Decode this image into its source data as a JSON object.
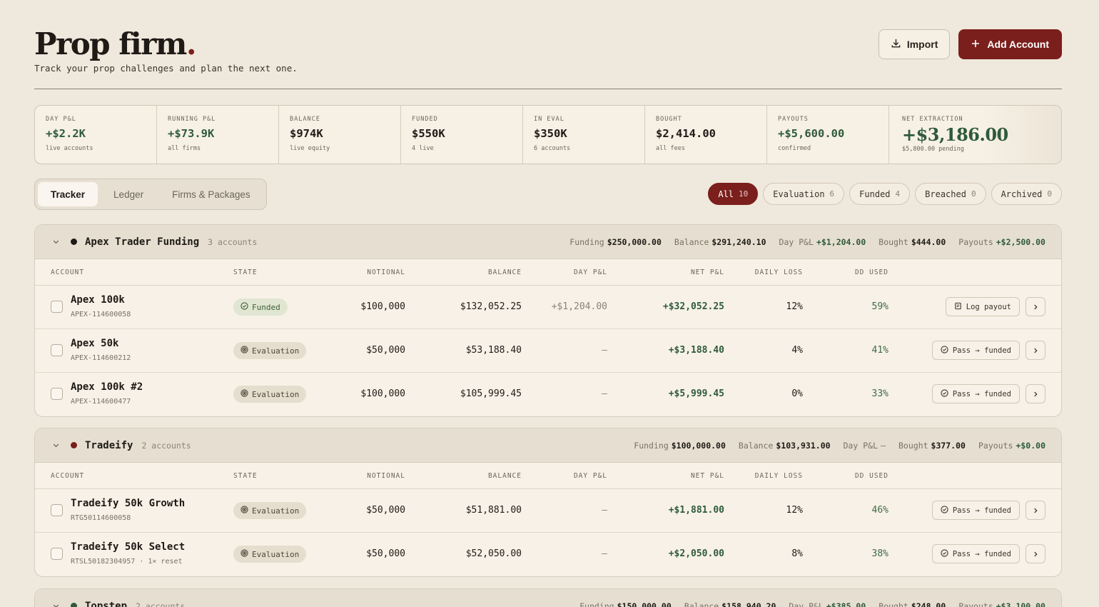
{
  "header": {
    "title": "Prop firm",
    "title_dot": ".",
    "subtitle": "Track your prop challenges and plan the next one.",
    "import_label": "Import",
    "add_label": "Add Account"
  },
  "stats": [
    {
      "label": "DAY P&L",
      "value": "+$2.2K",
      "sub": "live accounts"
    },
    {
      "label": "RUNNING P&L",
      "value": "+$73.9K",
      "sub": "all firms"
    },
    {
      "label": "BALANCE",
      "value": "$974K",
      "sub": "live equity"
    },
    {
      "label": "FUNDED",
      "value": "$550K",
      "sub": "4 live"
    },
    {
      "label": "IN EVAL",
      "value": "$350K",
      "sub": "6 accounts"
    },
    {
      "label": "BOUGHT",
      "value": "$2,414.00",
      "sub": "all fees"
    },
    {
      "label": "PAYOUTS",
      "value": "+$5,600.00",
      "sub": "confirmed"
    },
    {
      "label": "NET EXTRACTION",
      "value": "+$3,186.00",
      "sub": "$5,800.00 pending"
    }
  ],
  "tabs": [
    "Tracker",
    "Ledger",
    "Firms & Packages"
  ],
  "filters": [
    {
      "label": "All",
      "count": "10"
    },
    {
      "label": "Evaluation",
      "count": "6"
    },
    {
      "label": "Funded",
      "count": "4"
    },
    {
      "label": "Breached",
      "count": "0"
    },
    {
      "label": "Archived",
      "count": "0"
    }
  ],
  "columns": [
    "ACCOUNT",
    "STATE",
    "NOTIONAL",
    "BALANCE",
    "DAY P&L",
    "NET P&L",
    "DAILY LOSS",
    "DD USED"
  ],
  "group_stat_labels": {
    "funding": "Funding",
    "balance": "Balance",
    "day": "Day P&L",
    "bought": "Bought",
    "payouts": "Payouts"
  },
  "colors": {
    "accent": "#7a1f1c",
    "positive": "#2f5a3a"
  },
  "groups": [
    {
      "name": "Apex Trader Funding",
      "count": "3 accounts",
      "dot_color": "#1e1a16",
      "funding": "$250,000.00",
      "balance": "$291,240.10",
      "day": "+$1,204.00",
      "bought": "$444.00",
      "payouts": "+$2,500.00",
      "rows": [
        {
          "name": "Apex 100k",
          "id": "APEX-114600058",
          "state": "Funded",
          "notional": "$100,000",
          "balance": "$132,052.25",
          "day": "+$1,204.00",
          "net": "+$32,052.25",
          "daily_loss": "12%",
          "dd_used": "59%",
          "action": "Log payout"
        },
        {
          "name": "Apex 50k",
          "id": "APEX-114600212",
          "state": "Evaluation",
          "notional": "$50,000",
          "balance": "$53,188.40",
          "day": "—",
          "net": "+$3,188.40",
          "daily_loss": "4%",
          "dd_used": "41%",
          "action": "Pass → funded"
        },
        {
          "name": "Apex 100k #2",
          "id": "APEX-114600477",
          "state": "Evaluation",
          "notional": "$100,000",
          "balance": "$105,999.45",
          "day": "—",
          "net": "+$5,999.45",
          "daily_loss": "0%",
          "dd_used": "33%",
          "action": "Pass → funded"
        }
      ]
    },
    {
      "name": "Tradeify",
      "count": "2 accounts",
      "dot_color": "#7a1f1c",
      "funding": "$100,000.00",
      "balance": "$103,931.00",
      "day": "—",
      "bought": "$377.00",
      "payouts": "+$0.00",
      "rows": [
        {
          "name": "Tradeify 50k Growth",
          "id": "RTG50114600058",
          "state": "Evaluation",
          "notional": "$50,000",
          "balance": "$51,881.00",
          "day": "—",
          "net": "+$1,881.00",
          "daily_loss": "12%",
          "dd_used": "46%",
          "action": "Pass → funded"
        },
        {
          "name": "Tradeify 50k Select",
          "id": "RTSL50182304957 · 1× reset",
          "state": "Evaluation",
          "notional": "$50,000",
          "balance": "$52,050.00",
          "day": "—",
          "net": "+$2,050.00",
          "daily_loss": "8%",
          "dd_used": "38%",
          "action": "Pass → funded"
        }
      ]
    },
    {
      "name": "Topstep",
      "count": "2 accounts",
      "dot_color": "#2f5a3a",
      "funding": "$150,000.00",
      "balance": "$158,940.20",
      "day": "+$385.00",
      "bought": "$248.00",
      "payouts": "+$3,100.00",
      "rows": []
    }
  ]
}
